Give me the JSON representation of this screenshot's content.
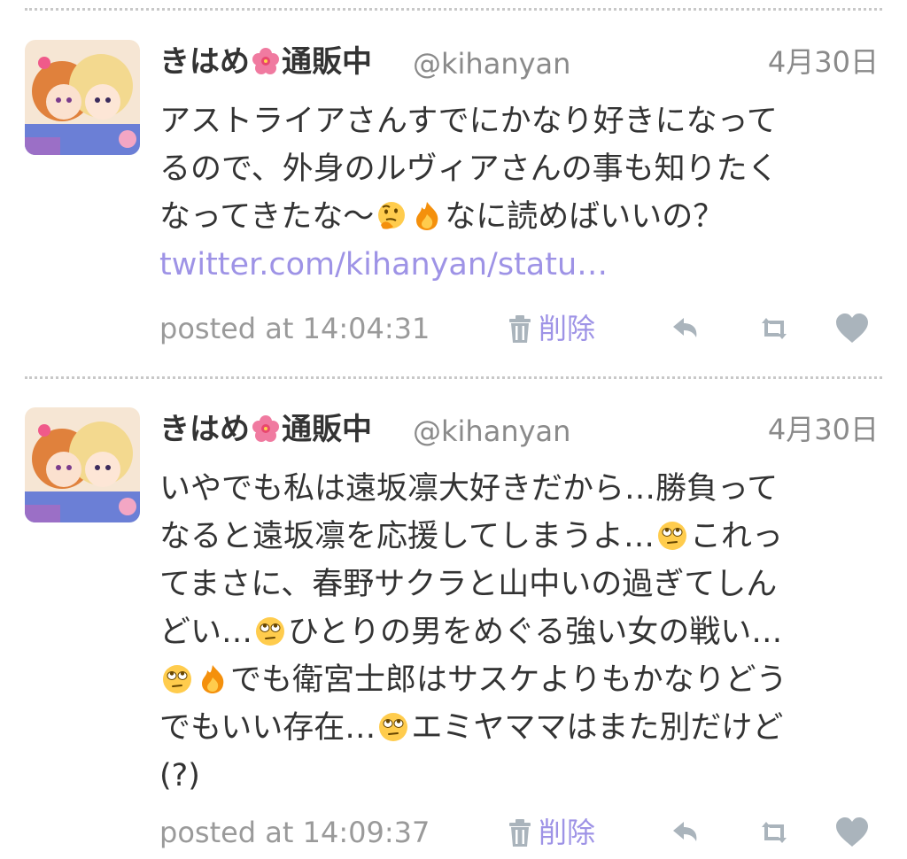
{
  "colors": {
    "link": "#9e93e6",
    "muted": "#9a9a9a",
    "text": "#333333",
    "icon": "#aab4bc"
  },
  "tweets": [
    {
      "name_part1": "きはめ",
      "name_part2": "通販中",
      "name_emoji": "hibiscus-icon",
      "handle": "@kihanyan",
      "date": "4月30日",
      "lines": [
        {
          "a": "アストライアさんすでにかなり好きになって"
        },
        {
          "a": "るので、外身のルヴィアさんの事も知りたく"
        },
        {
          "a": "なってきたな〜",
          "e1": "thinking-face-icon",
          "e2": "fire-icon",
          "b": "なに読めばいいの？"
        }
      ],
      "link": "twitter.com/kihanyan/statu…",
      "posted": "posted at 14:04:31",
      "delete_label": "削除",
      "actions": [
        "reply-icon",
        "retweet-icon",
        "like-icon"
      ]
    },
    {
      "name_part1": "きはめ",
      "name_part2": "通販中",
      "name_emoji": "hibiscus-icon",
      "handle": "@kihanyan",
      "date": "4月30日",
      "lines": [
        {
          "a": "いやでも私は遠坂凛大好きだから…勝負って"
        },
        {
          "a": "なると遠坂凛を応援してしまうよ…",
          "e1": "rolling-eyes-icon",
          "b": "これっ"
        },
        {
          "a": "てまさに、春野サクラと山中いの過ぎてしん"
        },
        {
          "a": "どい…",
          "e1": "rolling-eyes-icon",
          "b": "ひとりの男をめぐる強い女の戦い…"
        },
        {
          "a": "",
          "e1": "rolling-eyes-icon",
          "e2": "fire-icon",
          "b": "でも衛宮士郎はサスケよりもかなりどう"
        },
        {
          "a": "でもいい存在…",
          "e1": "rolling-eyes-icon",
          "b": "エミヤママはまた別だけど"
        },
        {
          "a": "(?)"
        }
      ],
      "posted": "posted at 14:09:37",
      "delete_label": "削除",
      "actions": [
        "reply-icon",
        "retweet-icon",
        "like-icon"
      ]
    }
  ]
}
